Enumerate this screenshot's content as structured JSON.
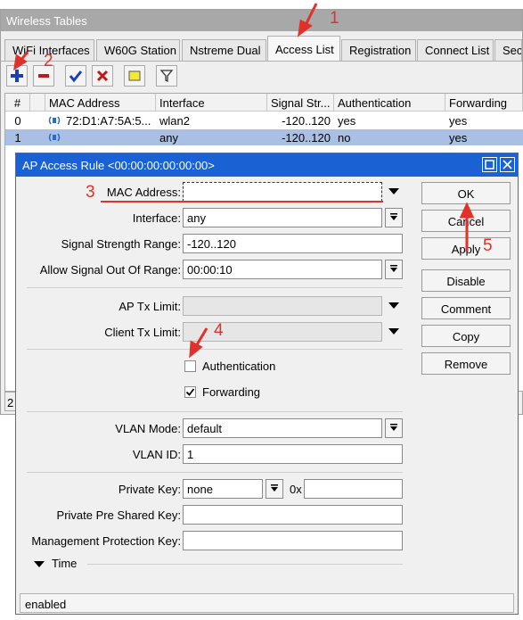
{
  "window": {
    "title": "Wireless Tables",
    "tabs": [
      {
        "label": "WiFi Interfaces"
      },
      {
        "label": "W60G Station"
      },
      {
        "label": "Nstreme Dual"
      },
      {
        "label": "Access List"
      },
      {
        "label": "Registration"
      },
      {
        "label": "Connect List"
      },
      {
        "label": "Secu"
      }
    ],
    "active_tab": "Access List",
    "toolbar": [
      "add-icon",
      "remove-icon",
      "enable-icon",
      "disable-icon",
      "comment-icon",
      "filter-icon"
    ],
    "table": {
      "columns": [
        "#",
        "MAC Address",
        "Interface",
        "Signal Str...",
        "Authentication",
        "Forwarding"
      ],
      "rows": [
        {
          "num": "0",
          "mac": "72:D1:A7:5A:5...",
          "interface": "wlan2",
          "signal": "-120..120",
          "auth": "yes",
          "forwarding": "yes",
          "selected": false
        },
        {
          "num": "1",
          "mac": "",
          "interface": "any",
          "signal": "-120..120",
          "auth": "no",
          "forwarding": "yes",
          "selected": true
        }
      ]
    },
    "status_count": "2"
  },
  "dialog": {
    "title": "AP Access Rule <00:00:00:00:00:00>",
    "fields": {
      "mac_address": {
        "label": "MAC Address:",
        "value": ""
      },
      "interface": {
        "label": "Interface:",
        "value": "any"
      },
      "signal_range": {
        "label": "Signal Strength Range:",
        "value": "-120..120"
      },
      "allow_signal": {
        "label": "Allow Signal Out Of Range:",
        "value": "00:00:10"
      },
      "ap_tx_limit": {
        "label": "AP Tx Limit:",
        "value": ""
      },
      "client_tx_limit": {
        "label": "Client Tx Limit:",
        "value": ""
      },
      "authentication": {
        "label": "Authentication",
        "checked": false
      },
      "forwarding": {
        "label": "Forwarding",
        "checked": true
      },
      "vlan_mode": {
        "label": "VLAN Mode:",
        "value": "default"
      },
      "vlan_id": {
        "label": "VLAN ID:",
        "value": "1"
      },
      "private_key": {
        "label": "Private Key:",
        "value": "none",
        "hex_prefix": "0x",
        "hex_value": ""
      },
      "private_psk": {
        "label": "Private Pre Shared Key:",
        "value": ""
      },
      "mgmt_key": {
        "label": "Management Protection Key:",
        "value": ""
      }
    },
    "time_section": "Time",
    "buttons": [
      "OK",
      "Cancel",
      "Apply",
      "Disable",
      "Comment",
      "Copy",
      "Remove"
    ],
    "status": "enabled"
  },
  "annotations": [
    "1",
    "2",
    "3",
    "4",
    "5"
  ],
  "colors": {
    "accent": "#1a62d4",
    "selected_row": "#aabfe4",
    "annotation": "#e0322a"
  }
}
